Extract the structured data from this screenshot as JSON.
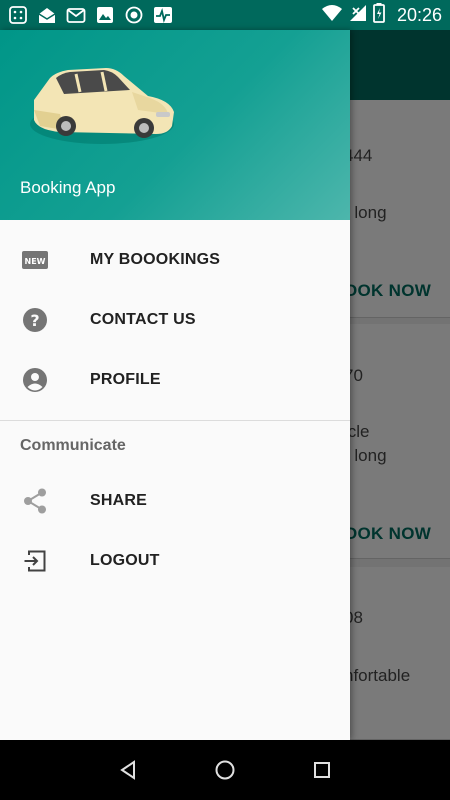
{
  "status_bar": {
    "time": "20:26",
    "left_icons": [
      "notification-icon",
      "mail-open-icon",
      "mail-icon",
      "image-icon",
      "record-icon",
      "activity-icon"
    ],
    "right_icons": [
      "wifi-icon",
      "signal-icon",
      "battery-charging-icon"
    ]
  },
  "background": {
    "cards": [
      {
        "line1": "444",
        "line2": "r long",
        "action": "OOK NOW"
      },
      {
        "line1": "70",
        "line2": "icle",
        "line3": "r long",
        "action": "OOK NOW"
      },
      {
        "line1": "08",
        "line2": "nfortable"
      }
    ]
  },
  "drawer": {
    "header": {
      "app_name": "Booking App"
    },
    "menu": [
      {
        "label": "MY BOOOKINGS",
        "icon": "new-badge-icon"
      },
      {
        "label": "CONTACT US",
        "icon": "help-circle-icon"
      },
      {
        "label": "PROFILE",
        "icon": "account-circle-icon"
      }
    ],
    "section_title": "Communicate",
    "section_items": [
      {
        "label": "SHARE",
        "icon": "share-icon"
      },
      {
        "label": "LOGOUT",
        "icon": "logout-icon"
      }
    ]
  },
  "colors": {
    "primary": "#00695c",
    "header_gradient_start": "#009688",
    "header_gradient_end": "#4db6ac"
  }
}
